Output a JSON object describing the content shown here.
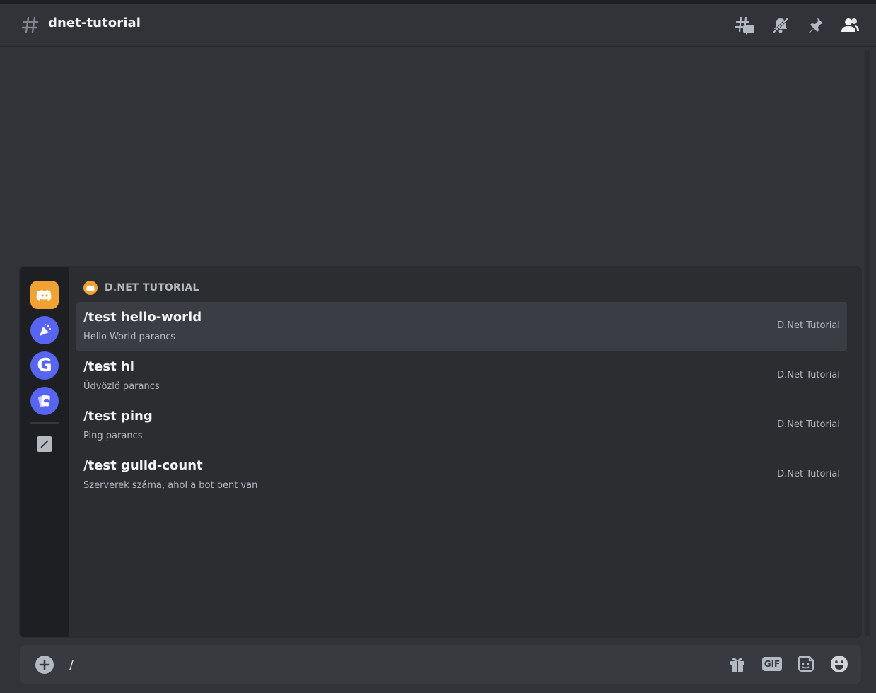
{
  "channel": {
    "name": "dnet-tutorial"
  },
  "header_icons": [
    "threads-icon",
    "notifications-muted-icon",
    "pin-icon",
    "members-icon"
  ],
  "popup": {
    "section_title": "D.NET TUTORIAL",
    "commands": [
      {
        "name": "/test hello-world",
        "description": "Hello World parancs",
        "source": "D.Net Tutorial",
        "selected": true
      },
      {
        "name": "/test hi",
        "description": "Üdvözlő parancs",
        "source": "D.Net Tutorial",
        "selected": false
      },
      {
        "name": "/test ping",
        "description": "Ping parancs",
        "source": "D.Net Tutorial",
        "selected": false
      },
      {
        "name": "/test guild-count",
        "description": "Szerverek száma, ahol a bot bent van",
        "source": "D.Net Tutorial",
        "selected": false
      }
    ],
    "rail_items": [
      "discord-app-icon",
      "party-app-icon",
      "google-app-icon",
      "cards-app-icon",
      "edit-icon"
    ]
  },
  "composer": {
    "value": "/",
    "icons": [
      "gift-icon",
      "gif-icon",
      "sticker-icon",
      "emoji-icon"
    ],
    "gif_label": "GIF"
  },
  "colors": {
    "background": "#313338",
    "popup": "#2b2d31",
    "rail": "#1e1f22",
    "selected_row": "#3b3d44",
    "accent_orange": "#f0a232",
    "blurple": "#5865f2"
  }
}
